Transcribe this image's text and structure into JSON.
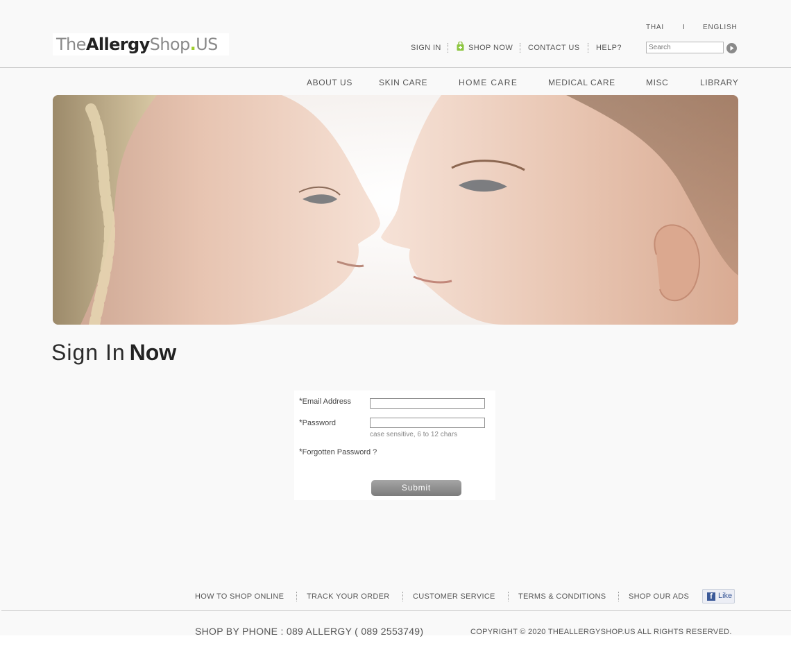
{
  "logo": {
    "the": "The",
    "allergy": "Allergy",
    "shop": "Shop",
    "dot": ".",
    "us": "US"
  },
  "language": {
    "thai": "THAI",
    "separator": "I",
    "english": "ENGLISH"
  },
  "top_nav": {
    "sign_in": "SIGN IN",
    "shop_now": "SHOP NOW",
    "contact_us": "CONTACT US",
    "help": "HELP?"
  },
  "search": {
    "placeholder": "Search",
    "value": ""
  },
  "main_nav": {
    "about_us": "ABOUT US",
    "skin_care": "SKIN CARE",
    "home_care": "HOME CARE",
    "medical_care": "MEDICAL CARE",
    "misc": "MISC",
    "library": "LIBRARY"
  },
  "page_title": {
    "light": "Sign In",
    "bold": "Now"
  },
  "form": {
    "star": "*",
    "email_label": "Email Address",
    "email_value": "",
    "password_label": "Password",
    "password_value": "",
    "password_hint": "case sensitive, 6 to 12 chars",
    "forgot_label": "Forgotten Password ?",
    "submit_label": "Submit"
  },
  "footer_nav": {
    "how_to_shop": "HOW TO SHOP ONLINE",
    "track_order": "TRACK YOUR ORDER",
    "customer_service": "CUSTOMER SERVICE",
    "terms": "TERMS & CONDITIONS",
    "shop_ads": "SHOP OUR ADS"
  },
  "facebook": {
    "icon": "f",
    "like_label": "Like"
  },
  "footer": {
    "phone": "SHOP BY PHONE : 089 ALLERGY ( 089 2553749)",
    "copyright": "COPYRIGHT © 2020 THEALLERGYSHOP.US  ALL RIGHTS RESERVED."
  },
  "colors": {
    "accent_green": "#9fce2c",
    "facebook_blue": "#3b5998",
    "submit_gray": "#8e8e8e"
  },
  "icons": {
    "shop_now": "shopping-bag-plus-icon",
    "search_go": "arrow-right-circle-icon",
    "facebook": "facebook-icon"
  }
}
